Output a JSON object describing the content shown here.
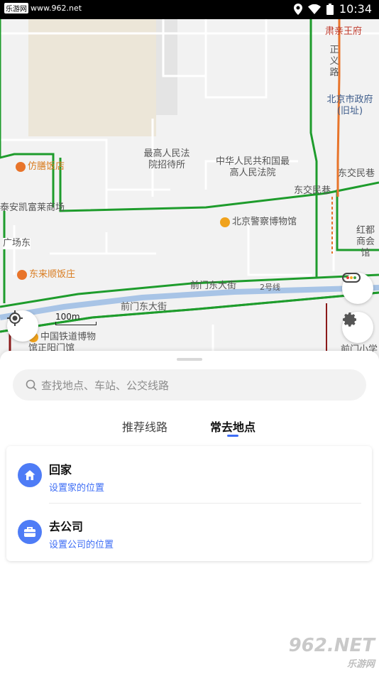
{
  "status_bar": {
    "site_label": "乐游网",
    "site_url": "www.962.net",
    "time": "10:34"
  },
  "map": {
    "pois": [
      {
        "name": "肃亲王府",
        "style": "red"
      },
      {
        "name": "正义路",
        "style": "gray"
      },
      {
        "name": "北京市政府(旧址)",
        "style": "blue"
      },
      {
        "name": "最高人民法院招待所",
        "style": "gray"
      },
      {
        "name": "中华人民共和国最高人民法院",
        "style": "gray"
      },
      {
        "name": "仿膳饭店",
        "style": "orange"
      },
      {
        "name": "东交民巷",
        "style": "gray"
      },
      {
        "name": "东交民巷",
        "style": "gray"
      },
      {
        "name": "泰安凯富莱商场",
        "style": "gray"
      },
      {
        "name": "北京警察博物馆",
        "style": "gray"
      },
      {
        "name": "红都商会馆",
        "style": "gray"
      },
      {
        "name": "广场东",
        "style": "gray"
      },
      {
        "name": "东来顺饭庄",
        "style": "orange"
      },
      {
        "name": "前门东大街",
        "style": "gray"
      },
      {
        "name": "2号线",
        "style": "gray"
      },
      {
        "name": "前门东大街",
        "style": "gray"
      },
      {
        "name": "中国铁道博物馆正阳门馆",
        "style": "gray"
      },
      {
        "name": "前门小学",
        "style": "gray"
      }
    ],
    "scale_label": "100m",
    "colors": {
      "green_route": "#1e9c2c",
      "orange_road": "#e8742a",
      "subway": "#a8c4e6"
    }
  },
  "search": {
    "placeholder": "查找地点、车站、公交线路"
  },
  "tabs": [
    {
      "label": "推荐线路",
      "active": false
    },
    {
      "label": "常去地点",
      "active": true
    }
  ],
  "places": [
    {
      "title": "回家",
      "subtitle": "设置家的位置",
      "icon": "home-icon"
    },
    {
      "title": "去公司",
      "subtitle": "设置公司的位置",
      "icon": "briefcase-icon"
    }
  ],
  "watermark": {
    "brand": "962.NET",
    "label": "乐游网"
  },
  "accent_color": "#3d6df5"
}
